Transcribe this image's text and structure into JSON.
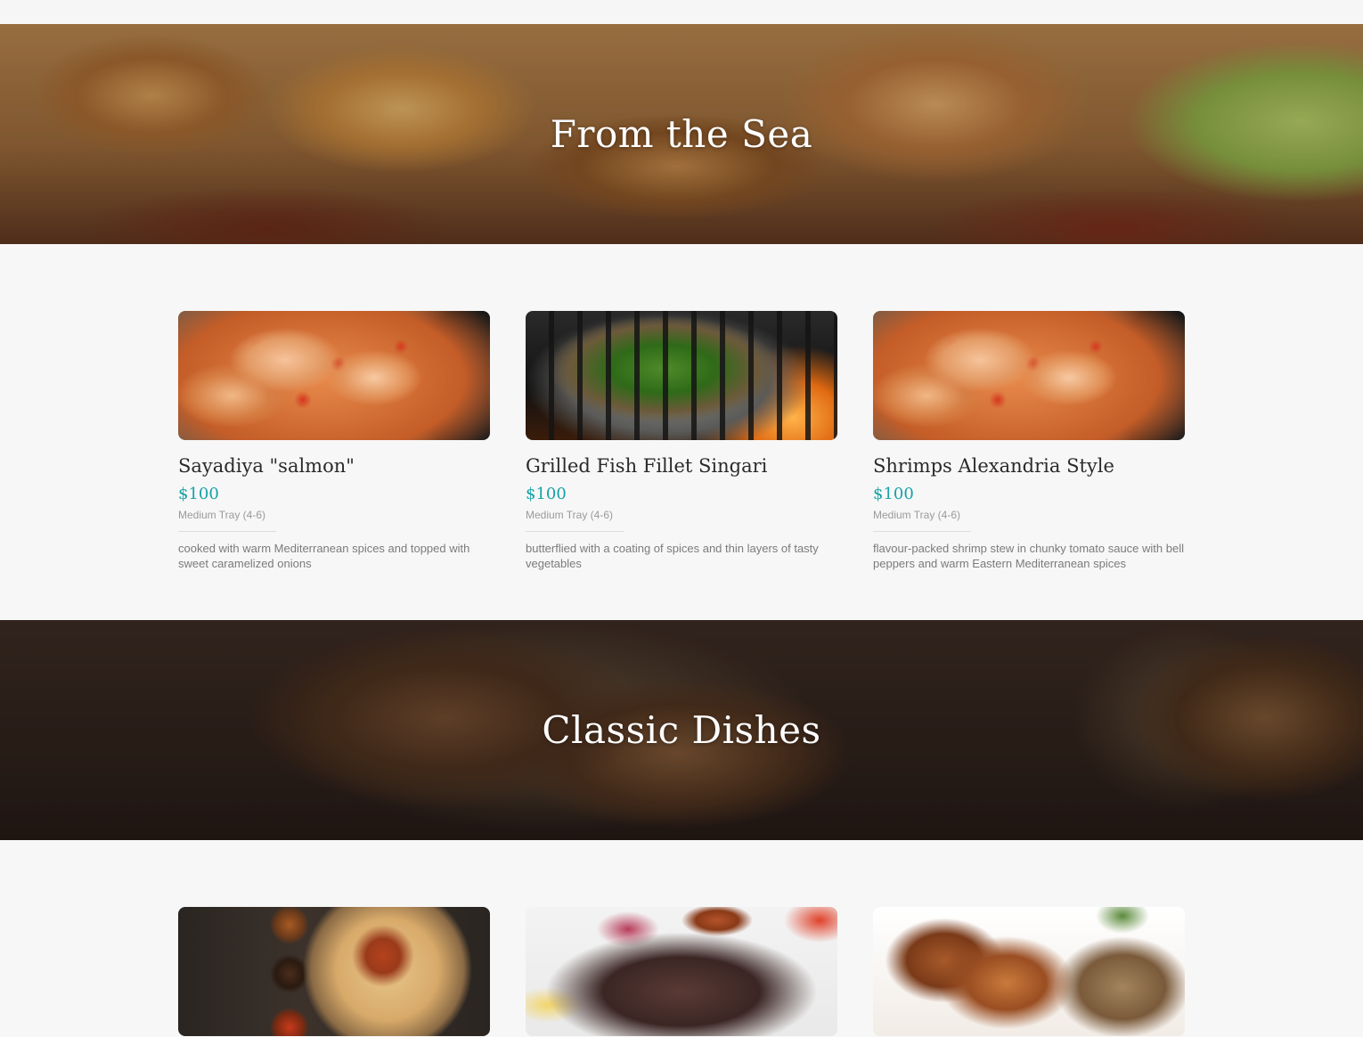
{
  "sections": [
    {
      "title": "From the Sea",
      "items": [
        {
          "name": "Sayadiya \"salmon\"",
          "price": "$100",
          "size": "Medium Tray (4-6)",
          "description": "cooked with warm Mediterranean spices and topped with sweet caramelized onions"
        },
        {
          "name": "Grilled Fish Fillet Singari",
          "price": "$100",
          "size": "Medium Tray (4-6)",
          "description": "butterflied with a coating of spices and thin layers of tasty vegetables"
        },
        {
          "name": "Shrimps Alexandria Style",
          "price": "$100",
          "size": "Medium Tray (4-6)",
          "description": "flavour-packed shrimp stew in chunky tomato sauce with bell peppers and warm Eastern Mediterranean spices"
        }
      ]
    },
    {
      "title": "Classic Dishes"
    }
  ],
  "colors": {
    "price": "#17a2a8",
    "background": "#f7f7f7"
  }
}
